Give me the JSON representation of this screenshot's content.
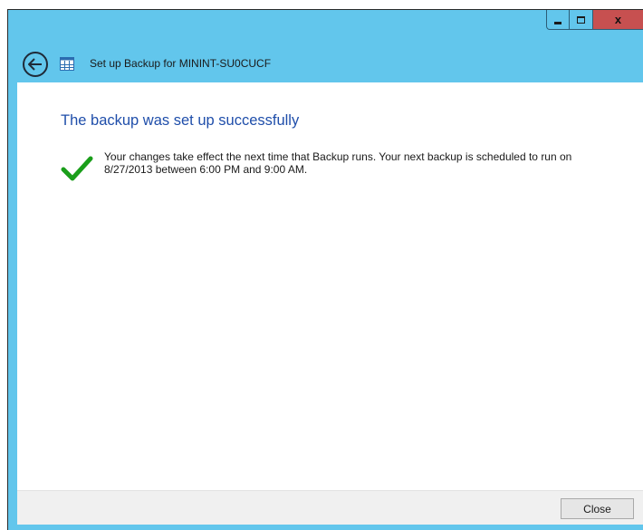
{
  "window": {
    "controls": {
      "minimize_icon": "minimize-icon",
      "maximize_icon": "maximize-icon",
      "close_icon": "close-icon",
      "close_glyph": "x"
    }
  },
  "navbar": {
    "title": "Set up Backup for MININT-SU0CUCF",
    "back_icon": "back-arrow-icon",
    "app_icon": "backup-app-icon"
  },
  "main": {
    "heading": "The backup was set up successfully",
    "status_icon": "checkmark-icon",
    "message": "Your changes take effect the next time that Backup runs. Your next backup is scheduled to run on 8/27/2013 between 6:00 PM and 9:00 AM."
  },
  "footer": {
    "close_label": "Close"
  },
  "colors": {
    "chrome": "#62c6ec",
    "close_button_red": "#c75050",
    "heading_blue": "#1f4eaa",
    "check_green": "#1a9e1a",
    "footer_bg": "#f0f0f0"
  }
}
